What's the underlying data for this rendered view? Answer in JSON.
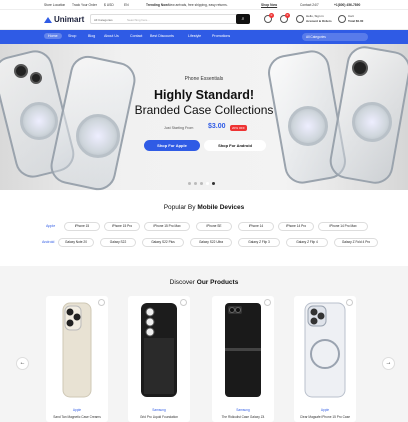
{
  "topbar": {
    "t1": "Store Location",
    "t2": "Track Your Order",
    "t3": "$ USD",
    "t4": "EN",
    "promo_bold": "Trending Now:",
    "promo": "New arrivals, free shipping, easy returns.",
    "promo_link": "Shop Now",
    "support": "Contact 24/7",
    "phone": "+1(800) 456-7890"
  },
  "header": {
    "logo": "Unimart",
    "search_category": "All Categories",
    "search_placeholder": "Searching here...",
    "search_btn": "⌕",
    "wish_count": "0",
    "cart_count": "0",
    "account_top": "Hello, Sign in",
    "account_main": "Account & Orders",
    "cart_label": "Cart",
    "cart_total": "Total $0.00"
  },
  "nav": {
    "items": [
      "Home",
      "Shop",
      "Blog",
      "About Us",
      "Contact",
      "Best Discounts",
      "Lifestyle",
      "Promotions"
    ],
    "category_btn": "All Categories"
  },
  "hero": {
    "eyebrow": "Phone Essentials",
    "title": "Highly Standard!",
    "subtitle": "Branded Case Collections",
    "from_label": "Just Starting From",
    "price": "$3.00",
    "badge": "20% OFF",
    "btn_apple": "Shop For Apple",
    "btn_android": "Shop For Android"
  },
  "mobile": {
    "title_plain": "Popular By",
    "title_bold": "Mobile Devices",
    "apple_label": "Apple",
    "apple": [
      "iPhone 15",
      "iPhone 15 Pro",
      "iPhone 15 Pro Max",
      "iPhone SE",
      "iPhone 14",
      "iPhone 14 Pro",
      "iPhone 14 Pro Max"
    ],
    "android_label": "Android",
    "android": [
      "Galaxy Note 20",
      "Galaxy S22",
      "Galaxy S22 Plus",
      "Galaxy S22 Ultra",
      "Galaxy Z Flip 3",
      "Galaxy Z Flip 4",
      "Galaxy Z Fold 4 Pro"
    ]
  },
  "products": {
    "title_plain": "Discover",
    "title_bold": "Our Products",
    "prev": "←",
    "next": "→",
    "items": [
      {
        "brand": "Apple",
        "name": "Sand Tan Magnetic Case Creams"
      },
      {
        "brand": "Samsung",
        "name": "Grid Pro Liquid Foundation"
      },
      {
        "brand": "Samsung",
        "name": "The Ridiculist Case Galaxy Z4"
      },
      {
        "brand": "Apple",
        "name": "Clear Magsafe iPhone 15 Pro Case"
      }
    ]
  }
}
